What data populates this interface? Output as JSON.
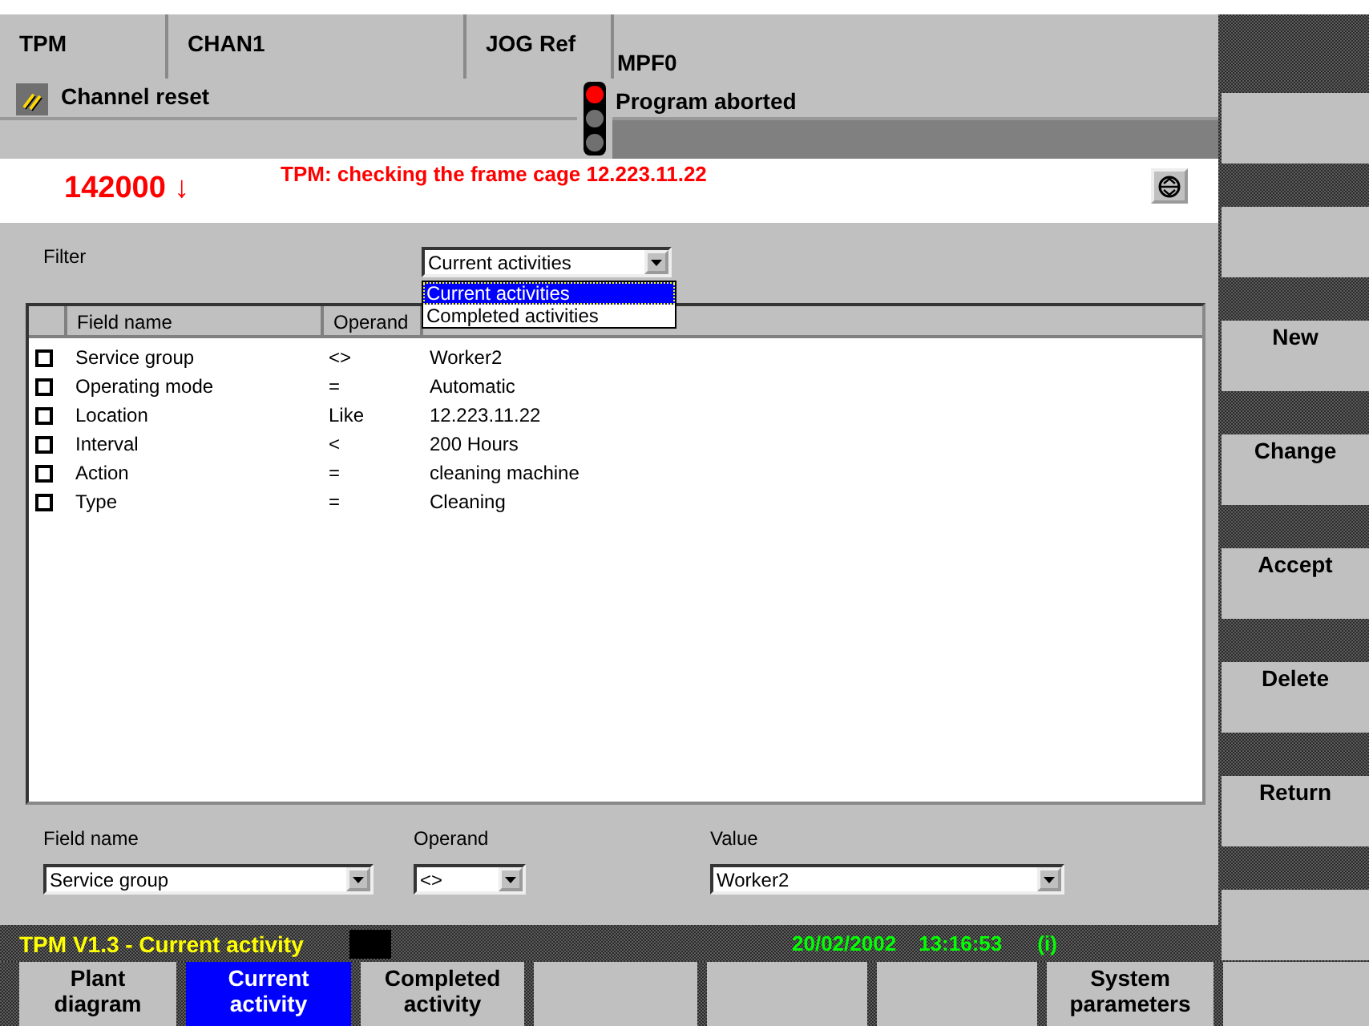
{
  "header": {
    "application": "TPM",
    "channel": "CHAN1",
    "mode": "JOG Ref",
    "program": "MPF0"
  },
  "channel_status": "Channel reset",
  "traffic_light": {
    "lamps": [
      {
        "on": true
      },
      {
        "on": false
      },
      {
        "on": false
      }
    ]
  },
  "program_status": "Program aborted",
  "alarm": {
    "number": "142000",
    "arrow": "↓",
    "message": "TPM: checking the frame cage 12.223.11.22"
  },
  "filter": {
    "label": "Filter",
    "value": "Current activities",
    "open": true,
    "options": [
      {
        "label": "Current activities",
        "selected": true
      },
      {
        "label": "Completed activities",
        "selected": false
      }
    ]
  },
  "table": {
    "columns": [
      "Field name",
      "Operand"
    ],
    "rows": [
      {
        "checked": false,
        "field": "Service group",
        "operand": "<>",
        "value": "Worker2"
      },
      {
        "checked": false,
        "field": "Operating mode",
        "operand": "=",
        "value": "Automatic"
      },
      {
        "checked": false,
        "field": "Location",
        "operand": "Like",
        "value": "12.223.11.22"
      },
      {
        "checked": false,
        "field": "Interval",
        "operand": "<",
        "value": "200 Hours"
      },
      {
        "checked": false,
        "field": "Action",
        "operand": "=",
        "value": "cleaning machine"
      },
      {
        "checked": false,
        "field": "Type",
        "operand": "=",
        "value": "Cleaning"
      }
    ]
  },
  "editor": {
    "field_name": {
      "label": "Field name",
      "value": "Service group"
    },
    "operand": {
      "label": "Operand",
      "value": "<>"
    },
    "value": {
      "label": "Value",
      "value": "Worker2"
    }
  },
  "status_bar": {
    "title": "TPM V1.3 - Current activity",
    "date": "20/02/2002",
    "time": "13:16:53",
    "info": "(i)"
  },
  "vertical_softkeys": [
    {
      "label": "New"
    },
    {
      "label": "Change"
    },
    {
      "label": "Accept"
    },
    {
      "label": "Delete"
    },
    {
      "label": "Return"
    }
  ],
  "horizontal_softkeys": [
    {
      "label": "Plant diagram",
      "selected": false
    },
    {
      "label": "Current activity",
      "selected": true
    },
    {
      "label": "Completed activity",
      "selected": false
    },
    {
      "selected": false
    },
    {
      "selected": false
    },
    {
      "selected": false
    },
    {
      "label": "System parameters",
      "selected": false
    },
    {
      "selected": false
    }
  ]
}
